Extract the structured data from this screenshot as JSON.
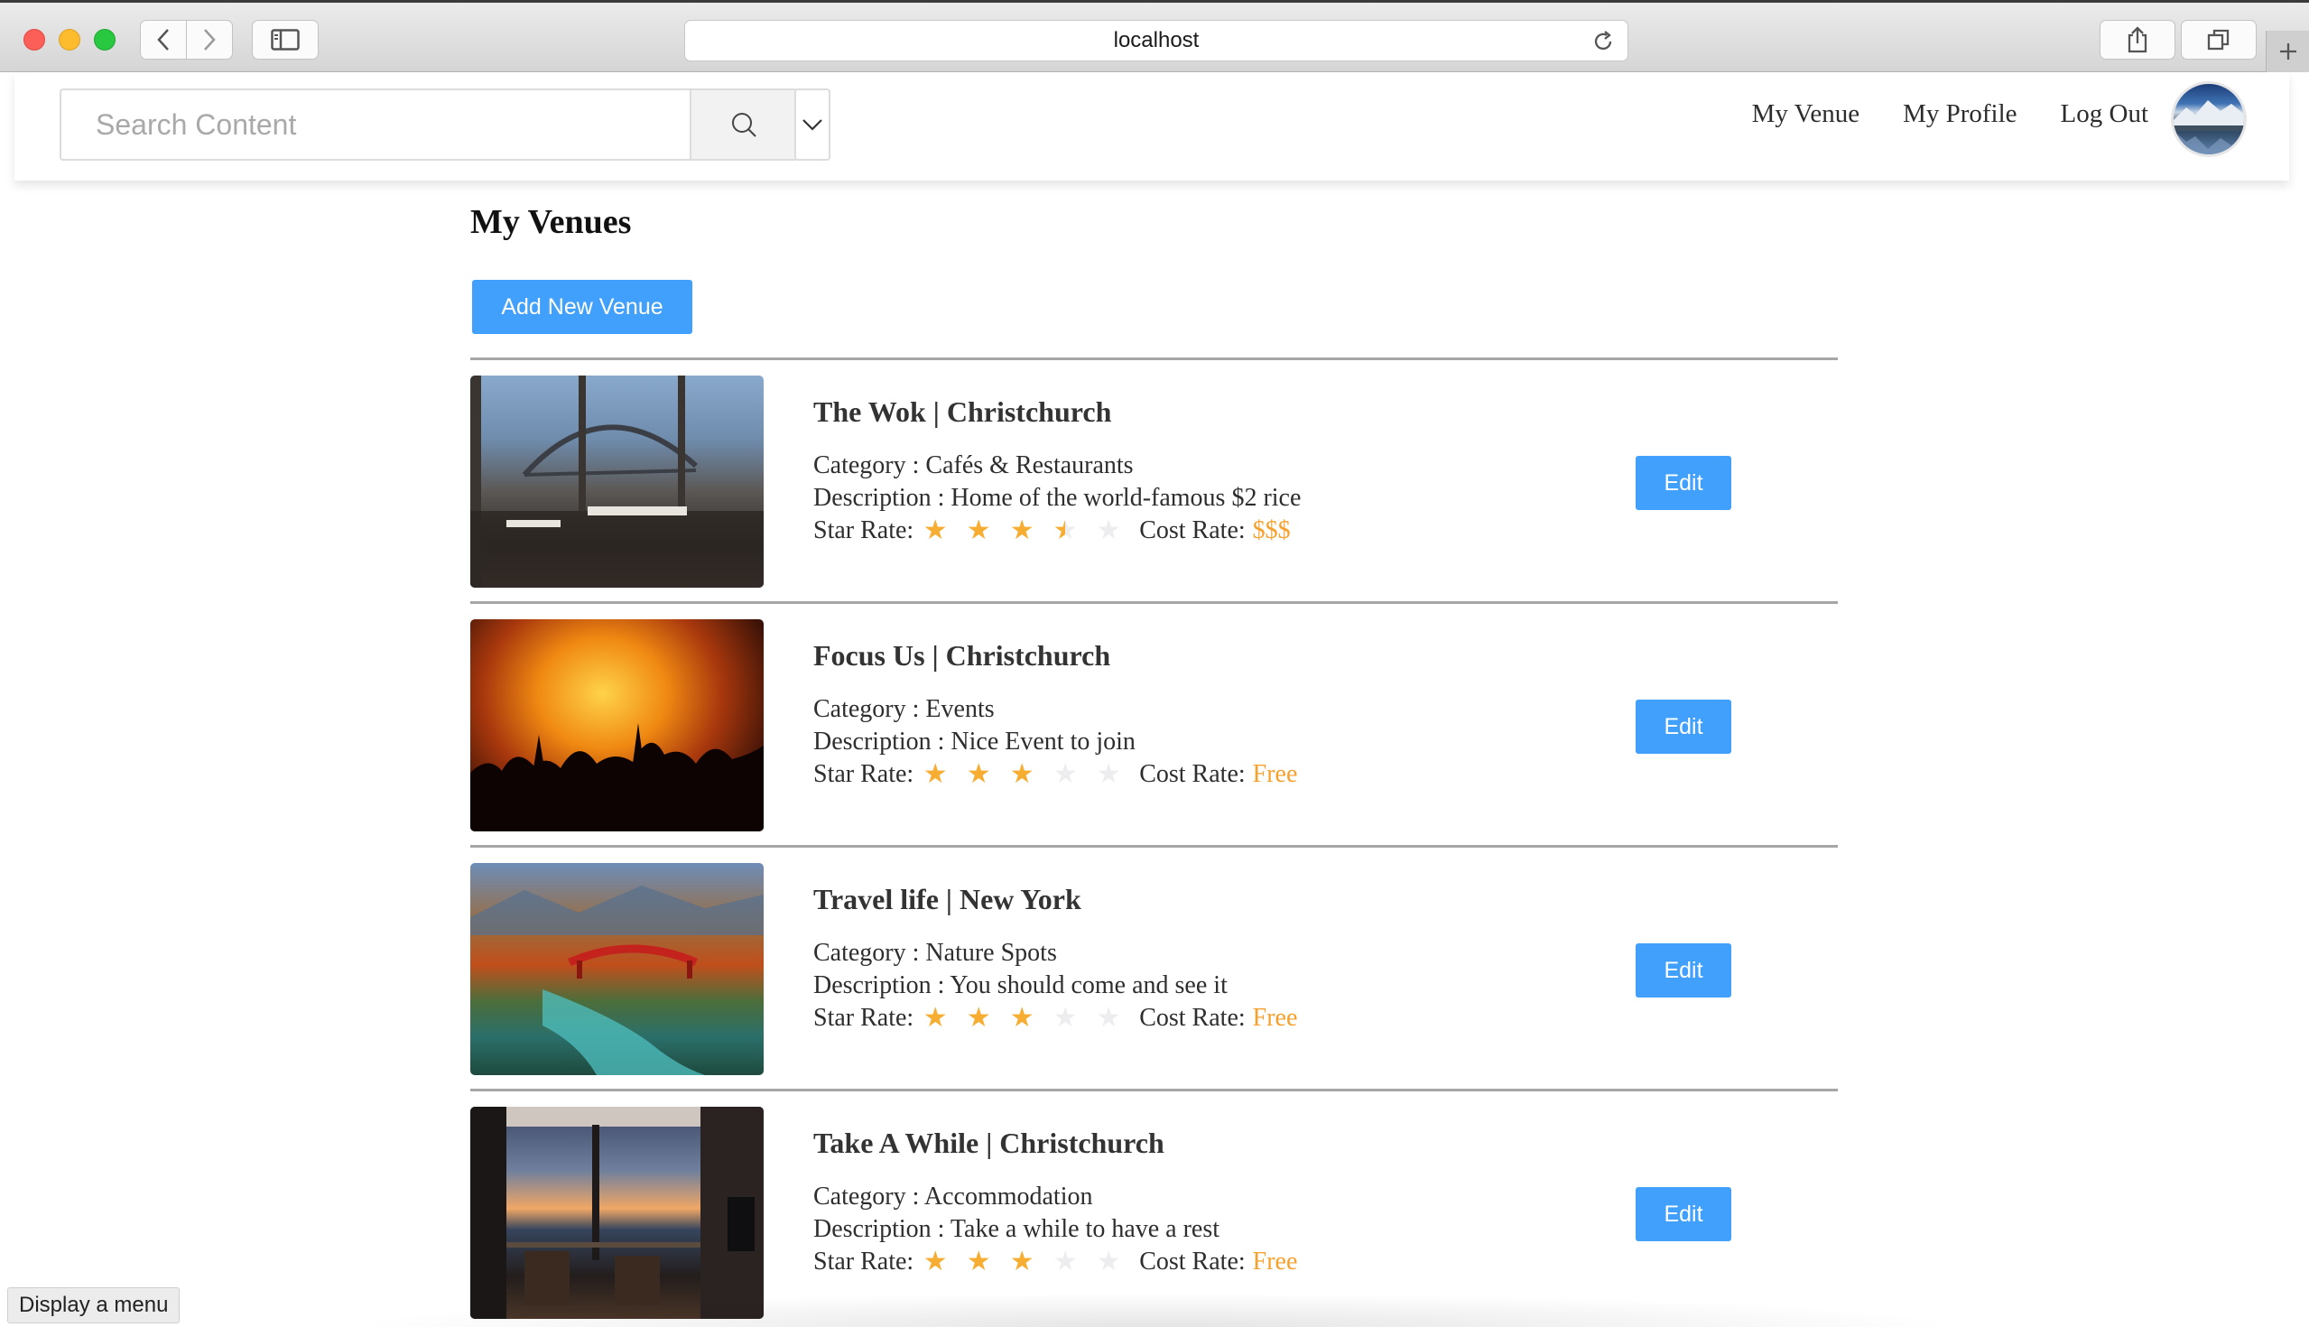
{
  "browser": {
    "url": "localhost"
  },
  "search": {
    "placeholder": "Search Content"
  },
  "nav": {
    "links": [
      "My Venue",
      "My Profile",
      "Log Out"
    ]
  },
  "page": {
    "title": "My Venues",
    "add_button": "Add New Venue",
    "edit_label": "Edit",
    "star_label": "Star Rate:",
    "cost_label": "Cost Rate:"
  },
  "venues": [
    {
      "title": "The Wok | Christchurch",
      "category": "Category : Cafés & Restaurants",
      "description": "Description : Home of the world-famous $2 rice",
      "stars": [
        "full",
        "full",
        "full",
        "half",
        "empty"
      ],
      "cost": "$$$"
    },
    {
      "title": "Focus Us | Christchurch",
      "category": "Category : Events",
      "description": "Description : Nice Event to join",
      "stars": [
        "full",
        "full",
        "full",
        "empty",
        "empty"
      ],
      "cost": "Free"
    },
    {
      "title": "Travel life | New York",
      "category": "Category : Nature Spots",
      "description": "Description : You should come and see it",
      "stars": [
        "full",
        "full",
        "full",
        "empty",
        "empty"
      ],
      "cost": "Free"
    },
    {
      "title": "Take A While | Christchurch",
      "category": "Category : Accommodation",
      "description": "Description : Take a while to have a rest",
      "stars": [
        "full",
        "full",
        "full",
        "empty",
        "empty"
      ],
      "cost": "Free"
    }
  ],
  "status_tip": "Display a menu",
  "colors": {
    "accent_button": "#40a0fc",
    "star": "#f7ad32",
    "cost": "#f7a02c"
  }
}
